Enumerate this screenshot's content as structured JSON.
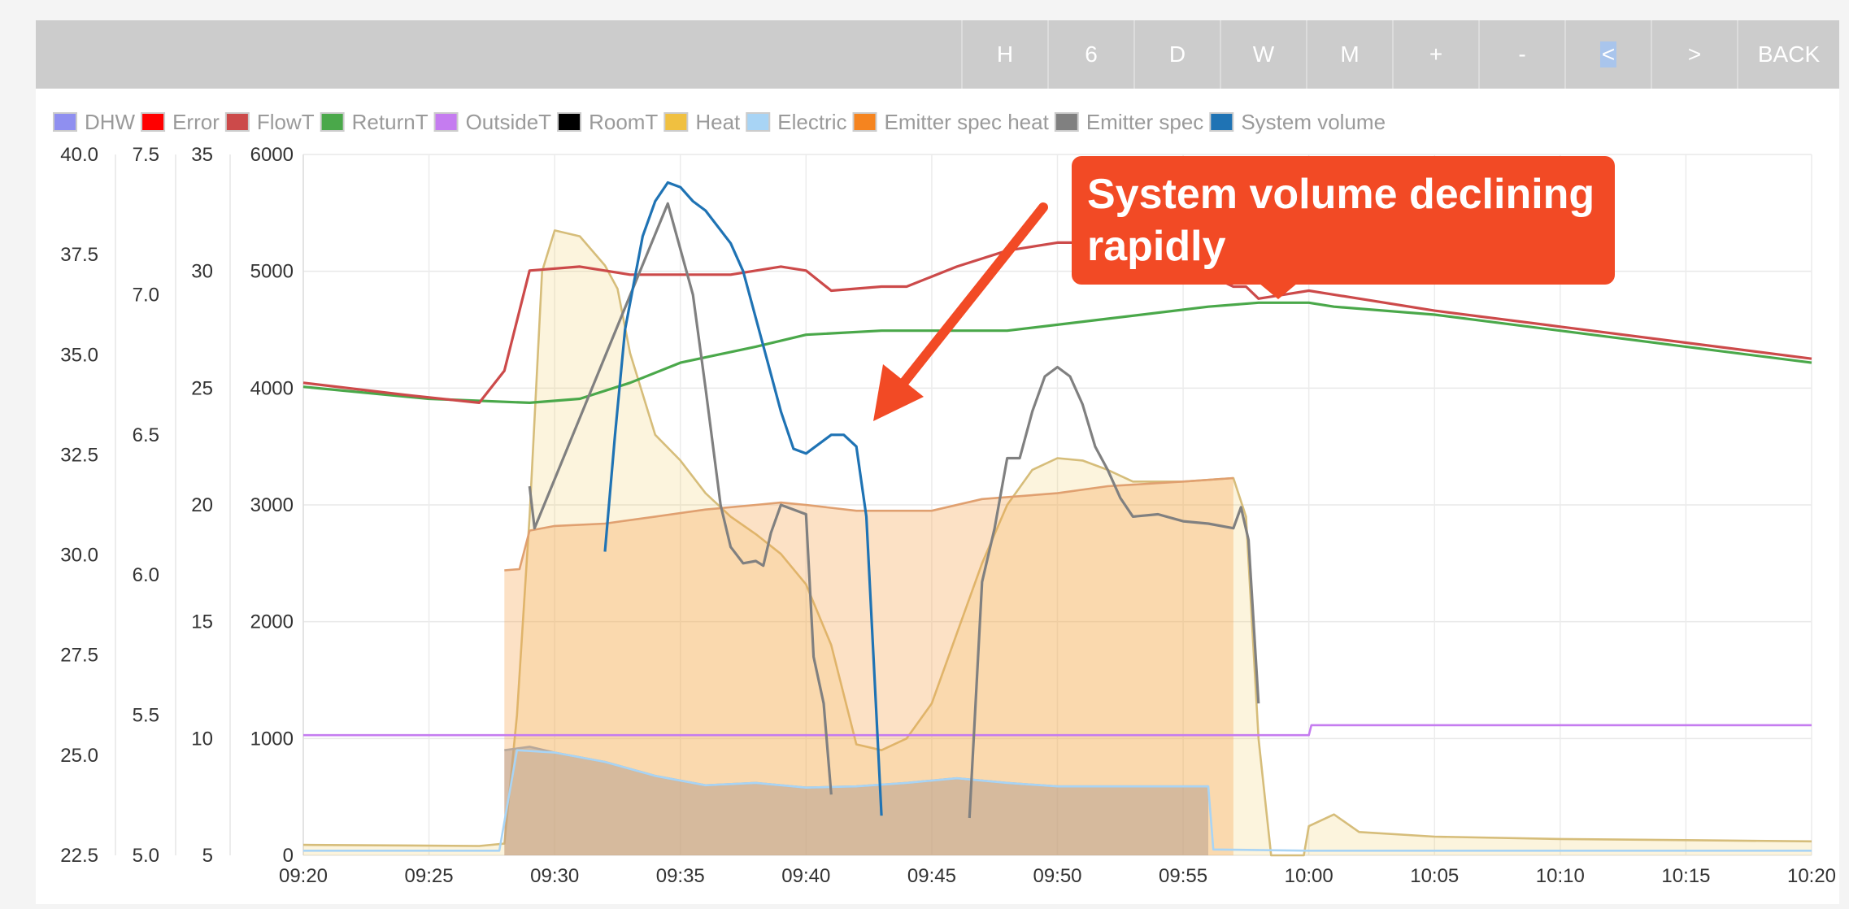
{
  "toolbar": {
    "buttons": [
      "H",
      "6",
      "D",
      "W",
      "M",
      "+",
      "-",
      "<",
      ">",
      "BACK"
    ],
    "selected": "<"
  },
  "legend": [
    {
      "name": "DHW",
      "color": "#8f8ff0"
    },
    {
      "name": "Error",
      "color": "#ff0000"
    },
    {
      "name": "FlowT",
      "color": "#cc4a4a"
    },
    {
      "name": "ReturnT",
      "color": "#4aa84a"
    },
    {
      "name": "OutsideT",
      "color": "#c57cf0"
    },
    {
      "name": "RoomT",
      "color": "#000000"
    },
    {
      "name": "Heat",
      "color": "#f0c040"
    },
    {
      "name": "Electric",
      "color": "#a8d4f5"
    },
    {
      "name": "Emitter spec heat",
      "color": "#f5841f"
    },
    {
      "name": "Emitter spec",
      "color": "#808080"
    },
    {
      "name": "System volume",
      "color": "#1f73b4"
    }
  ],
  "annotation": {
    "text_line1": "System volume declining",
    "text_line2": "rapidly",
    "color": "#f24a25"
  },
  "chart_data": {
    "type": "line",
    "x_unit": "time",
    "xlim": [
      "09:20",
      "10:20"
    ],
    "x_ticks": [
      "09:20",
      "09:25",
      "09:30",
      "09:35",
      "09:40",
      "09:45",
      "09:50",
      "09:55",
      "10:00",
      "10:05",
      "10:10",
      "10:15",
      "10:20"
    ],
    "axes": [
      {
        "id": "temp",
        "ylim": [
          22.5,
          40.0
        ],
        "ticks": [
          "40.0",
          "37.5",
          "35.0",
          "32.5",
          "30.0",
          "27.5",
          "25.0",
          "22.5"
        ]
      },
      {
        "id": "axis2",
        "ylim": [
          5.0,
          7.5
        ],
        "ticks": [
          "7.5",
          "7.0",
          "6.5",
          "6.0",
          "5.5",
          "5.0"
        ]
      },
      {
        "id": "axis3",
        "ylim": [
          5,
          35
        ],
        "ticks": [
          "35",
          "30",
          "25",
          "20",
          "15",
          "10",
          "5"
        ]
      },
      {
        "id": "power",
        "ylim": [
          0,
          6000
        ],
        "ticks": [
          "6000",
          "5000",
          "4000",
          "3000",
          "2000",
          "1000",
          "0"
        ]
      }
    ],
    "series": [
      {
        "name": "FlowT",
        "axis": "temp",
        "color": "#cc4a4a",
        "points": [
          [
            "09:20",
            34.3
          ],
          [
            "09:24",
            34.0
          ],
          [
            "09:27",
            33.8
          ],
          [
            "09:28",
            34.6
          ],
          [
            "09:29",
            37.1
          ],
          [
            "09:31",
            37.2
          ],
          [
            "09:33",
            37.0
          ],
          [
            "09:35",
            37.0
          ],
          [
            "09:37",
            37.0
          ],
          [
            "09:39",
            37.2
          ],
          [
            "09:40",
            37.1
          ],
          [
            "09:41",
            36.6
          ],
          [
            "09:43",
            36.7
          ],
          [
            "09:44",
            36.7
          ],
          [
            "09:46",
            37.2
          ],
          [
            "09:48",
            37.6
          ],
          [
            "09:50",
            37.8
          ],
          [
            "09:52",
            37.8
          ],
          [
            "09:54",
            37.6
          ],
          [
            "09:56",
            37.0
          ],
          [
            "09:57",
            36.7
          ],
          [
            "09:57.5",
            36.7
          ],
          [
            "09:58",
            36.4
          ],
          [
            "09:59",
            36.5
          ],
          [
            "10:00",
            36.6
          ],
          [
            "10:01",
            36.5
          ],
          [
            "10:05",
            36.1
          ],
          [
            "10:10",
            35.7
          ],
          [
            "10:15",
            35.3
          ],
          [
            "10:20",
            34.9
          ]
        ]
      },
      {
        "name": "ReturnT",
        "axis": "temp",
        "color": "#4aa84a",
        "points": [
          [
            "09:20",
            34.2
          ],
          [
            "09:25",
            33.9
          ],
          [
            "09:29",
            33.8
          ],
          [
            "09:31",
            33.9
          ],
          [
            "09:33",
            34.3
          ],
          [
            "09:35",
            34.8
          ],
          [
            "09:38",
            35.2
          ],
          [
            "09:40",
            35.5
          ],
          [
            "09:43",
            35.6
          ],
          [
            "09:46",
            35.6
          ],
          [
            "09:48",
            35.6
          ],
          [
            "09:52",
            35.9
          ],
          [
            "09:56",
            36.2
          ],
          [
            "09:58",
            36.3
          ],
          [
            "10:00",
            36.3
          ],
          [
            "10:01",
            36.2
          ],
          [
            "10:05",
            36.0
          ],
          [
            "10:10",
            35.6
          ],
          [
            "10:15",
            35.2
          ],
          [
            "10:20",
            34.8
          ]
        ]
      },
      {
        "name": "OutsideT",
        "axis": "temp",
        "color": "#c57cf0",
        "points": [
          [
            "09:20",
            25.5
          ],
          [
            "10:00",
            25.5
          ],
          [
            "10:00.1",
            25.75
          ],
          [
            "10:20",
            25.75
          ]
        ]
      },
      {
        "name": "System volume",
        "axis": "axis3",
        "color": "#1f73b4",
        "points": [
          [
            "09:32",
            18.0
          ],
          [
            "09:32.4",
            23.0
          ],
          [
            "09:32.8",
            27.5
          ],
          [
            "09:33.5",
            31.5
          ],
          [
            "09:34",
            33.0
          ],
          [
            "09:34.5",
            33.8
          ],
          [
            "09:35",
            33.6
          ],
          [
            "09:35.5",
            33.0
          ],
          [
            "09:36",
            32.6
          ],
          [
            "09:37",
            31.2
          ],
          [
            "09:37.5",
            30.0
          ],
          [
            "09:38",
            28.0
          ],
          [
            "09:38.5",
            26.0
          ],
          [
            "09:39",
            24.0
          ],
          [
            "09:39.5",
            22.4
          ],
          [
            "09:40",
            22.2
          ],
          [
            "09:40.5",
            22.6
          ],
          [
            "09:41",
            23.0
          ],
          [
            "09:41.5",
            23.0
          ],
          [
            "09:42",
            22.5
          ],
          [
            "09:42.4",
            19.5
          ],
          [
            "09:42.8",
            11.0
          ],
          [
            "09:43",
            6.7
          ]
        ]
      },
      {
        "name": "Emitter spec",
        "axis": "axis3",
        "color": "#808080",
        "points": [
          [
            "09:29",
            20.8
          ],
          [
            "09:29.2",
            19.0
          ],
          [
            "09:34.5",
            32.9
          ],
          [
            "09:35.5",
            29.0
          ],
          [
            "09:36",
            25.0
          ],
          [
            "09:36.6",
            20.0
          ],
          [
            "09:37",
            18.2
          ],
          [
            "09:37.5",
            17.5
          ],
          [
            "09:38",
            17.6
          ],
          [
            "09:38.3",
            17.4
          ],
          [
            "09:38.6",
            18.8
          ],
          [
            "09:39",
            20.0
          ],
          [
            "09:39.5",
            19.8
          ],
          [
            "09:40",
            19.6
          ],
          [
            "09:40.3",
            13.5
          ],
          [
            "09:40.7",
            11.5
          ],
          [
            "09:41",
            7.6
          ]
        ]
      },
      {
        "name": "Emitter spec",
        "axis": "axis3",
        "color": "#808080",
        "points": [
          [
            "09:46.5",
            6.6
          ],
          [
            "09:47",
            16.7
          ],
          [
            "09:47.5",
            19.0
          ],
          [
            "09:48",
            22.0
          ],
          [
            "09:48.5",
            22.0
          ],
          [
            "09:49",
            24.0
          ],
          [
            "09:49.5",
            25.5
          ],
          [
            "09:50",
            25.9
          ],
          [
            "09:50.5",
            25.5
          ],
          [
            "09:51",
            24.3
          ],
          [
            "09:51.5",
            22.5
          ],
          [
            "09:52",
            21.5
          ],
          [
            "09:52.5",
            20.3
          ],
          [
            "09:53",
            19.5
          ],
          [
            "09:54",
            19.6
          ],
          [
            "09:55",
            19.3
          ],
          [
            "09:56",
            19.2
          ],
          [
            "09:57",
            19.0
          ],
          [
            "09:57.3",
            19.9
          ],
          [
            "09:57.6",
            18.5
          ],
          [
            "09:58",
            11.5
          ]
        ]
      },
      {
        "name": "Heat",
        "axis": "power",
        "color": "#d6bd7a",
        "fill": "#f0c040",
        "fill_opacity": 0.18,
        "points": [
          [
            "09:20",
            90
          ],
          [
            "09:27",
            80
          ],
          [
            "09:28",
            100
          ],
          [
            "09:28.5",
            1200
          ],
          [
            "09:29",
            2900
          ],
          [
            "09:29.5",
            5000
          ],
          [
            "09:30",
            5350
          ],
          [
            "09:31",
            5300
          ],
          [
            "09:32",
            5050
          ],
          [
            "09:32.5",
            4850
          ],
          [
            "09:33",
            4300
          ],
          [
            "09:34",
            3600
          ],
          [
            "09:35",
            3380
          ],
          [
            "09:36",
            3100
          ],
          [
            "09:37",
            2900
          ],
          [
            "09:38",
            2750
          ],
          [
            "09:39",
            2580
          ],
          [
            "09:40",
            2320
          ],
          [
            "09:41",
            1800
          ],
          [
            "09:42",
            950
          ],
          [
            "09:43",
            900
          ],
          [
            "09:44",
            1000
          ],
          [
            "09:45",
            1300
          ],
          [
            "09:46",
            1900
          ],
          [
            "09:47",
            2500
          ],
          [
            "09:48",
            3000
          ],
          [
            "09:49",
            3300
          ],
          [
            "09:50",
            3400
          ],
          [
            "09:51",
            3380
          ],
          [
            "09:52",
            3300
          ],
          [
            "09:53",
            3200
          ],
          [
            "09:55",
            3200
          ],
          [
            "09:57",
            3230
          ],
          [
            "09:57.5",
            2900
          ],
          [
            "09:58",
            1000
          ],
          [
            "09:58.5",
            0
          ],
          [
            "09:59.8",
            0
          ],
          [
            "10:00",
            250
          ],
          [
            "10:01",
            350
          ],
          [
            "10:02",
            200
          ],
          [
            "10:05",
            160
          ],
          [
            "10:10",
            140
          ],
          [
            "10:15",
            130
          ],
          [
            "10:20",
            120
          ]
        ]
      },
      {
        "name": "Emitter spec heat",
        "axis": "power",
        "color": "#e0a070",
        "fill": "#f5a24a",
        "fill_opacity": 0.32,
        "points": [
          [
            "09:28",
            2440
          ],
          [
            "09:28.6",
            2450
          ],
          [
            "09:29",
            2780
          ],
          [
            "09:30",
            2820
          ],
          [
            "09:32",
            2840
          ],
          [
            "09:34",
            2900
          ],
          [
            "09:36",
            2960
          ],
          [
            "09:38",
            3000
          ],
          [
            "09:39",
            3020
          ],
          [
            "09:40",
            3000
          ],
          [
            "09:42",
            2950
          ],
          [
            "09:45",
            2950
          ],
          [
            "09:47",
            3050
          ],
          [
            "09:50",
            3100
          ],
          [
            "09:52",
            3160
          ],
          [
            "09:55",
            3200
          ],
          [
            "09:57",
            3230
          ]
        ]
      },
      {
        "name": "Electric",
        "axis": "power",
        "color": "#a8d4f5",
        "points": [
          [
            "09:20",
            40
          ],
          [
            "09:27.8",
            40
          ],
          [
            "09:28.5",
            900
          ],
          [
            "09:30",
            880
          ],
          [
            "09:32",
            800
          ],
          [
            "09:34",
            680
          ],
          [
            "09:36",
            600
          ],
          [
            "09:38",
            620
          ],
          [
            "09:40",
            580
          ],
          [
            "09:42",
            590
          ],
          [
            "09:44",
            620
          ],
          [
            "09:46",
            660
          ],
          [
            "09:48",
            620
          ],
          [
            "09:50",
            590
          ],
          [
            "09:53",
            590
          ],
          [
            "09:56",
            590
          ],
          [
            "09:56.2",
            50
          ],
          [
            "10:00",
            40
          ],
          [
            "10:20",
            40
          ]
        ]
      },
      {
        "name": "Electric fill",
        "axis": "power",
        "color": "#b8a89a",
        "fill": "#b8a090",
        "fill_opacity": 0.55,
        "points": [
          [
            "09:28",
            900
          ],
          [
            "09:29",
            930
          ],
          [
            "09:30",
            880
          ],
          [
            "09:32",
            800
          ],
          [
            "09:34",
            680
          ],
          [
            "09:36",
            600
          ],
          [
            "09:38",
            620
          ],
          [
            "09:40",
            580
          ],
          [
            "09:42",
            590
          ],
          [
            "09:44",
            620
          ],
          [
            "09:46",
            660
          ],
          [
            "09:48",
            620
          ],
          [
            "09:50",
            590
          ],
          [
            "09:53",
            590
          ],
          [
            "09:56",
            590
          ]
        ]
      }
    ]
  }
}
